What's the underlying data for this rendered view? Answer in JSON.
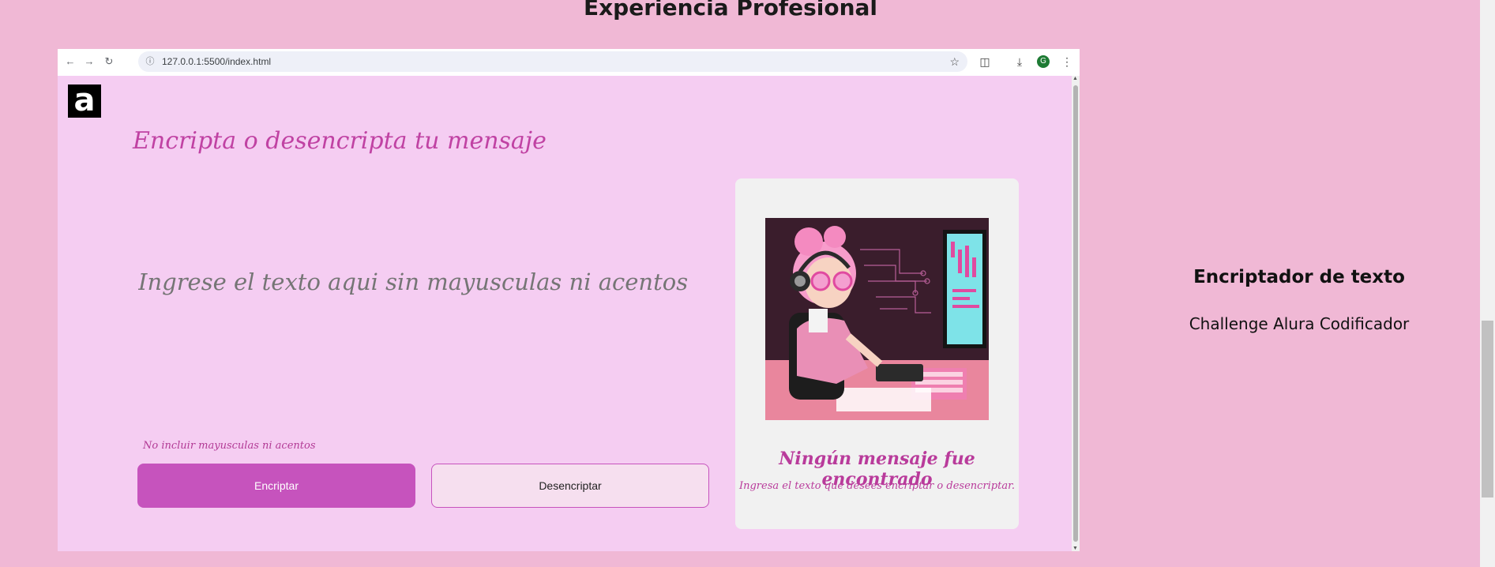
{
  "page": {
    "section_title": "Experiencia Profesional"
  },
  "browser": {
    "url": "127.0.0.1:5500/index.html",
    "profile_initial": "G"
  },
  "app": {
    "logo_letter": "a",
    "title": "Encripta o desencripta tu mensaje",
    "input_placeholder": "Ingrese el texto aqui sin mayusculas ni acentos",
    "hint": "No incluir mayusculas ni acentos",
    "encrypt_label": "Encriptar",
    "decrypt_label": "Desencriptar",
    "card_title": "Ningún mensaje fue encontrado",
    "card_text": "Ingresa el texto que desees encriptar o desencriptar."
  },
  "side": {
    "title": "Encriptador de texto",
    "subtitle": "Challenge Alura Codificador"
  },
  "colors": {
    "page_bg": "#f0b8d5",
    "viewport_bg": "#f5cdf2",
    "accent": "#c653bd"
  }
}
